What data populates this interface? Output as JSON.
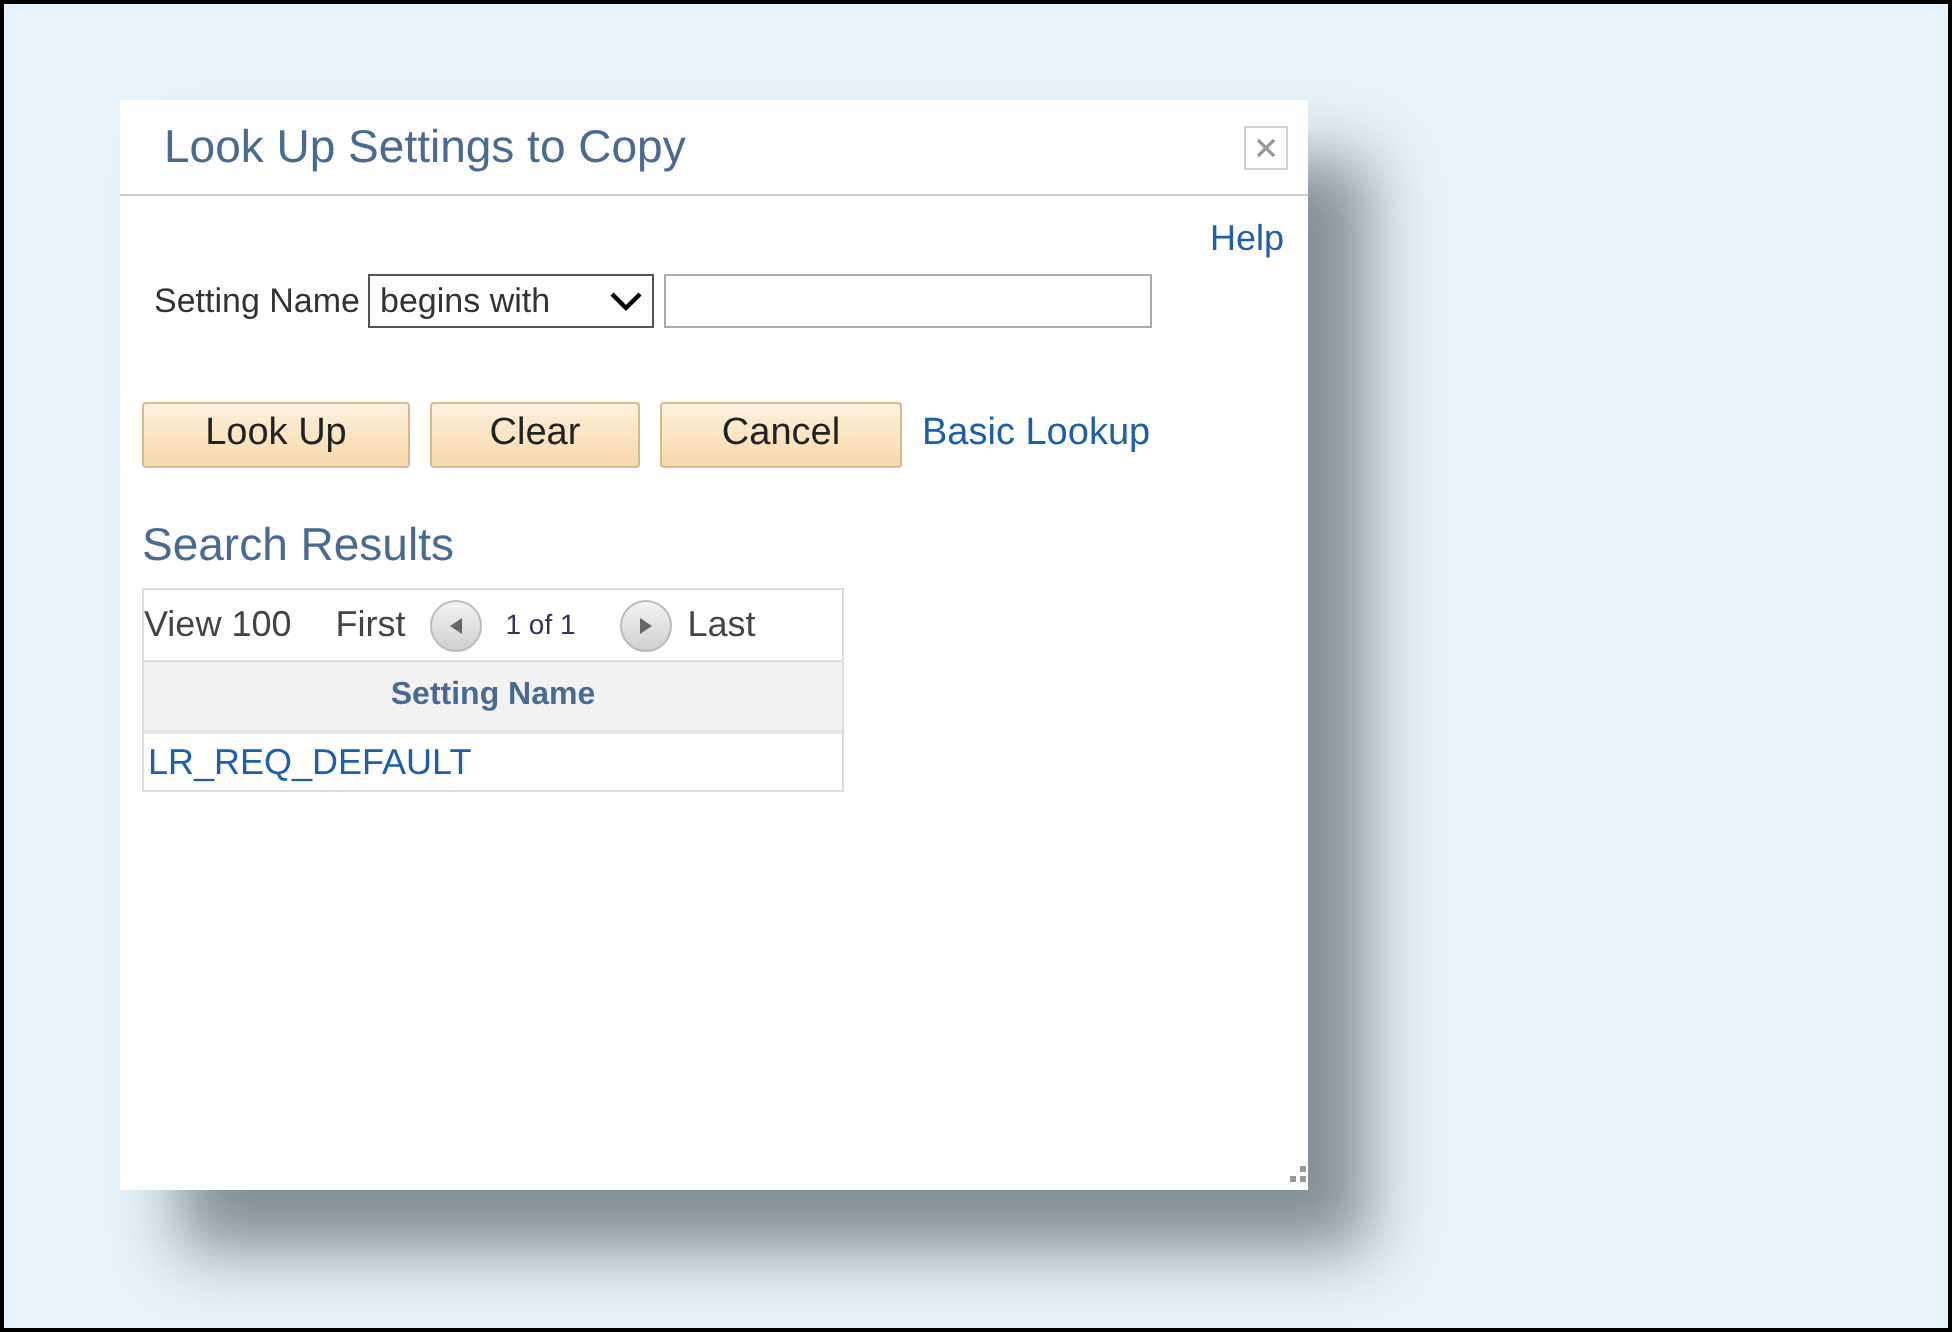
{
  "dialog": {
    "title": "Look Up Settings to Copy",
    "help": "Help",
    "search": {
      "label": "Setting Name",
      "operator": "begins with"
    },
    "buttons": [
      "Look Up",
      "Clear",
      "Cancel"
    ],
    "basic_lookup": "Basic Lookup",
    "results": {
      "title": "Search Results",
      "view": "View 100",
      "first": "First",
      "page": "1 of 1",
      "last": "Last",
      "columns": [
        "Setting Name"
      ],
      "rows": [
        [
          "LR_REQ_DEFAULT"
        ]
      ]
    }
  }
}
